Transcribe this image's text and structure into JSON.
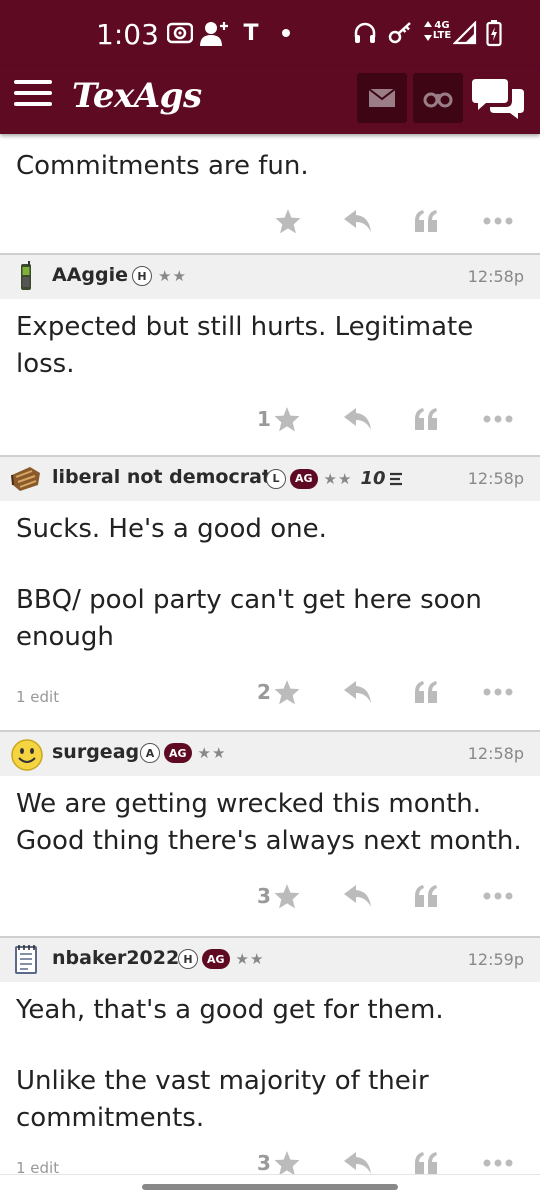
{
  "status_bar": {
    "time": "1:03",
    "left_icons": [
      "camera-icon",
      "person-add-icon",
      "t-mobile-icon",
      "dot-icon"
    ],
    "right_icons": [
      "headset-icon",
      "key-icon",
      "network-icon",
      "signal-icon",
      "battery-icon"
    ],
    "t_letter": "T",
    "net_top": "4G",
    "net_bottom": "LTE",
    "bg_color": "#5e0a23"
  },
  "toolbar": {
    "logo": "TexAgs",
    "icons": [
      "menu-icon",
      "mail-icon",
      "binoculars-icon",
      "chat-bubbles-icon"
    ]
  },
  "posts": [
    {
      "paragraphs": [
        "Commitments are fun."
      ],
      "likes": "",
      "edit_note": ""
    },
    {
      "user": "AAggie",
      "avatar": "phone-icon",
      "badges": [
        "H"
      ],
      "ag": "",
      "stars": "★★",
      "time": "12:58p",
      "paragraphs": [
        "Expected but still hurts. Legitimate loss."
      ],
      "likes": "1",
      "edit_note": ""
    },
    {
      "user": "liberal not democrat",
      "avatar": "brisket-icon",
      "badges": [
        "L"
      ],
      "ag": "AG",
      "stars": "★★",
      "extra": "10",
      "time": "12:58p",
      "paragraphs": [
        "Sucks. He's a good one.",
        "BBQ/ pool party can't get here soon enough"
      ],
      "likes": "2",
      "edit_note": "1 edit"
    },
    {
      "user": "surgeag",
      "avatar": "smiley-icon",
      "badges": [
        "A"
      ],
      "ag": "AG",
      "stars": "★★",
      "time": "12:58p",
      "paragraphs": [
        "We are getting wrecked this month. Good thing there's always next month."
      ],
      "likes": "3",
      "edit_note": ""
    },
    {
      "user": "nbaker2022",
      "avatar": "notepad-icon",
      "badges": [
        "H"
      ],
      "ag": "AG",
      "stars": "★★",
      "time": "12:59p",
      "paragraphs": [
        "Yeah, that's a good get for them.",
        "Unlike the vast majority of their commitments."
      ],
      "likes": "3",
      "edit_note": "1 edit"
    }
  ],
  "action_icons": [
    "star-icon",
    "reply-icon",
    "quote-icon",
    "more-icon"
  ],
  "colors": {
    "maroon": "#5e0a23",
    "header_gray": "#f0f0f0",
    "icon_gray": "#bbbbbb"
  }
}
